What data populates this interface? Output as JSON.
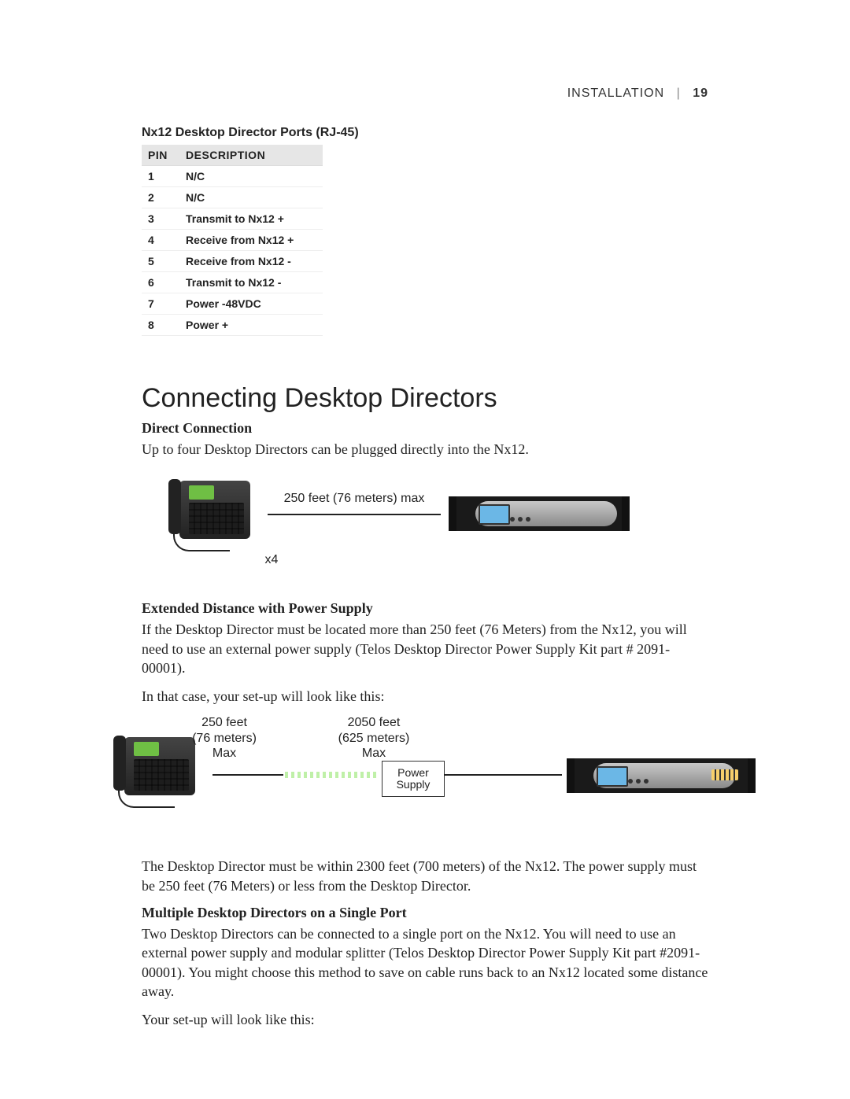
{
  "header": {
    "section": "INSTALLATION",
    "page": "19"
  },
  "table": {
    "title": "Nx12 Desktop Director Ports (RJ-45)",
    "col_pin": "Pin",
    "col_desc": "Description",
    "rows": [
      {
        "pin": "1",
        "desc": "N/C"
      },
      {
        "pin": "2",
        "desc": "N/C"
      },
      {
        "pin": "3",
        "desc": "Transmit to Nx12 +"
      },
      {
        "pin": "4",
        "desc": "Receive from Nx12 +"
      },
      {
        "pin": "5",
        "desc": "Receive from Nx12 -"
      },
      {
        "pin": "6",
        "desc": "Transmit to Nx12 -"
      },
      {
        "pin": "7",
        "desc": "Power -48VDC"
      },
      {
        "pin": "8",
        "desc": "Power +"
      }
    ]
  },
  "heading": "Connecting Desktop Directors",
  "direct": {
    "title": "Direct Connection",
    "p1": "Up to four Desktop Directors can be plugged directly into the Nx12."
  },
  "diagram1": {
    "distance": "250 feet (76 meters) max",
    "count": "x4"
  },
  "extended": {
    "title": "Extended Distance with Power Supply",
    "p1": "If the Desktop Director must be located more than 250 feet (76 Meters) from the Nx12, you will need to use an external power supply (Telos Desktop Director Power Supply Kit part # 2091-00001).",
    "p2": "In that case, your set-up will look like this:"
  },
  "diagram2": {
    "left_label": "250 feet\n(76 meters)\nMax",
    "right_label": "2050 feet\n(625 meters)\nMax",
    "psu": "Power\nSupply"
  },
  "after_d2": {
    "p1": "The Desktop Director must be within 2300 feet (700 meters) of the Nx12. The power supply must be 250 feet (76 Meters) or less from the Desktop Director."
  },
  "multi": {
    "title": "Multiple Desktop Directors on a Single Port",
    "p1": "Two Desktop Directors can be connected to a single port on the Nx12. You will need to use an external power supply and modular splitter (Telos Desktop Director Power Supply Kit part #2091-00001). You might choose this method to save on cable runs back to an Nx12 located some distance away.",
    "p2": "Your set-up will look like this:"
  }
}
